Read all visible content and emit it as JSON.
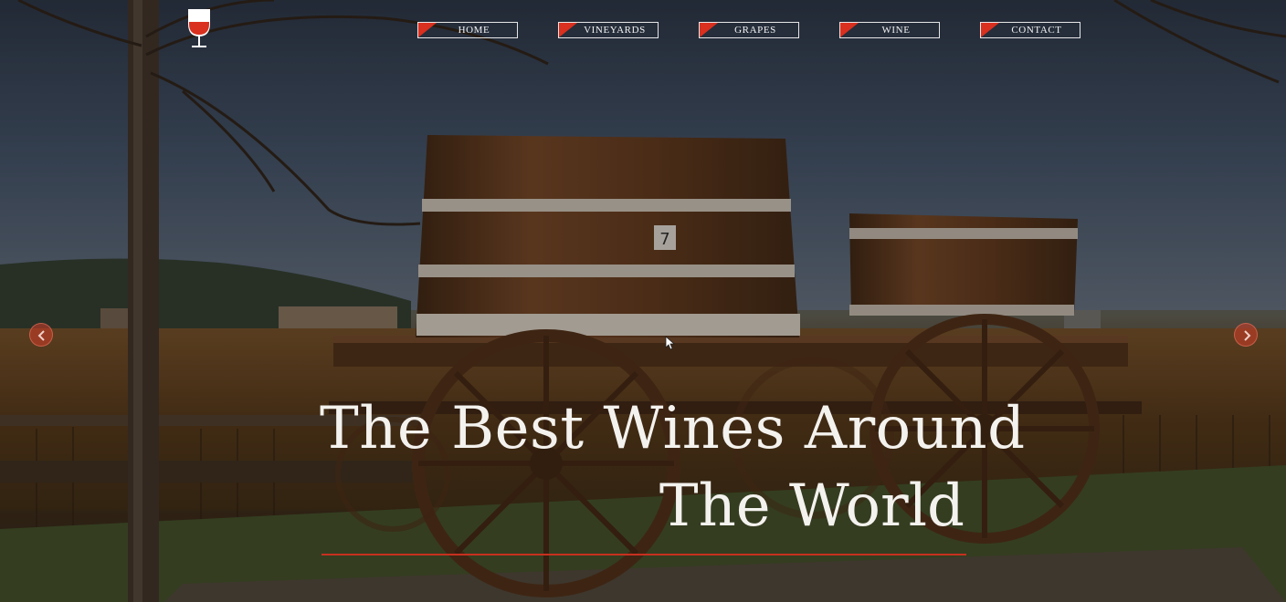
{
  "logo": {
    "icon": "wine-glass-icon"
  },
  "nav": {
    "items": [
      {
        "label": "HOME"
      },
      {
        "label": "VINEYARDS"
      },
      {
        "label": "GRAPES"
      },
      {
        "label": "WINE"
      },
      {
        "label": "CONTACT"
      }
    ]
  },
  "hero": {
    "headline_line1": "The Best Wines Around",
    "headline_line2": "The World",
    "barrel_number": "7"
  },
  "slider": {
    "prev_icon": "chevron-left-icon",
    "next_icon": "chevron-right-icon"
  },
  "colors": {
    "accent": "#d9301f",
    "nav_border": "#e6e6e6",
    "headline": "#f4f2ee"
  }
}
